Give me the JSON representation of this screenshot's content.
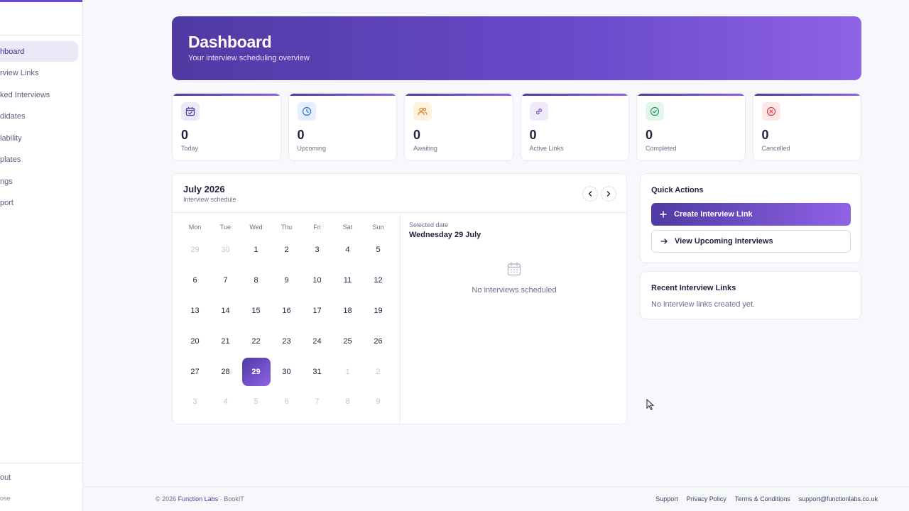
{
  "sidebar": {
    "items": [
      {
        "label": "Dashboard",
        "visible_text": "hboard",
        "active": true
      },
      {
        "label": "Interview Links",
        "visible_text": "rview Links"
      },
      {
        "label": "Booked Interviews",
        "visible_text": "ked Interviews"
      },
      {
        "label": "Candidates",
        "visible_text": "didates"
      },
      {
        "label": "Availability",
        "visible_text": "lability"
      },
      {
        "label": "Templates",
        "visible_text": "plates"
      },
      {
        "label": "Settings",
        "visible_text": "ngs"
      },
      {
        "label": "Support",
        "visible_text": "port"
      }
    ],
    "logout_text": "out",
    "collapse_text": "ose"
  },
  "hero": {
    "title": "Dashboard",
    "subtitle": "Your interview scheduling overview"
  },
  "stats": [
    {
      "value": "0",
      "label": "Today",
      "icon": "calendar-check-icon",
      "color": "#4f3aa3",
      "bg": "#ece8f8"
    },
    {
      "value": "0",
      "label": "Upcoming",
      "icon": "clock-icon",
      "color": "#2f6fe0",
      "bg": "#e6efff"
    },
    {
      "value": "0",
      "label": "Awaiting",
      "icon": "users-icon",
      "color": "#d98a1c",
      "bg": "#fff3e0"
    },
    {
      "value": "0",
      "label": "Active Links",
      "icon": "link-icon",
      "color": "#6a4bcc",
      "bg": "#f0ebfb"
    },
    {
      "value": "0",
      "label": "Completed",
      "icon": "check-circle-icon",
      "color": "#169a5a",
      "bg": "#e4f6ec"
    },
    {
      "value": "0",
      "label": "Cancelled",
      "icon": "x-circle-icon",
      "color": "#e0383e",
      "bg": "#fde8e8"
    }
  ],
  "calendar": {
    "month_title": "July 2026",
    "subtitle": "Interview schedule",
    "weekdays": [
      "Mon",
      "Tue",
      "Wed",
      "Thu",
      "Fri",
      "Sat",
      "Sun"
    ],
    "weeks": [
      [
        {
          "d": "29",
          "m": true
        },
        {
          "d": "30",
          "m": true
        },
        {
          "d": "1"
        },
        {
          "d": "2"
        },
        {
          "d": "3"
        },
        {
          "d": "4"
        },
        {
          "d": "5"
        }
      ],
      [
        {
          "d": "6"
        },
        {
          "d": "7"
        },
        {
          "d": "8"
        },
        {
          "d": "9"
        },
        {
          "d": "10"
        },
        {
          "d": "11"
        },
        {
          "d": "12"
        }
      ],
      [
        {
          "d": "13"
        },
        {
          "d": "14"
        },
        {
          "d": "15"
        },
        {
          "d": "16"
        },
        {
          "d": "17"
        },
        {
          "d": "18"
        },
        {
          "d": "19"
        }
      ],
      [
        {
          "d": "20"
        },
        {
          "d": "21"
        },
        {
          "d": "22"
        },
        {
          "d": "23"
        },
        {
          "d": "24"
        },
        {
          "d": "25"
        },
        {
          "d": "26"
        }
      ],
      [
        {
          "d": "27"
        },
        {
          "d": "28"
        },
        {
          "d": "29",
          "s": true
        },
        {
          "d": "30"
        },
        {
          "d": "31"
        },
        {
          "d": "1",
          "m": true
        },
        {
          "d": "2",
          "m": true
        }
      ],
      [
        {
          "d": "3",
          "m": true
        },
        {
          "d": "4",
          "m": true
        },
        {
          "d": "5",
          "m": true
        },
        {
          "d": "6",
          "m": true
        },
        {
          "d": "7",
          "m": true
        },
        {
          "d": "8",
          "m": true
        },
        {
          "d": "9",
          "m": true
        }
      ]
    ],
    "selected_label": "Selected date",
    "selected_date": "Wednesday 29 July",
    "empty_text": "No interviews scheduled"
  },
  "quick_actions": {
    "title": "Quick Actions",
    "create_label": "Create Interview Link",
    "view_label": "View Upcoming Interviews"
  },
  "recent_links": {
    "title": "Recent Interview Links",
    "empty_text": "No interview links created yet."
  },
  "footer": {
    "copyright": "© 2026 ",
    "brand": "Function Labs",
    "product": " · BookIT",
    "links": [
      "Support",
      "Privacy Policy",
      "Terms & Conditions",
      "support@functionlabs.co.uk"
    ]
  },
  "colors": {
    "accent": "#4f3aa3",
    "accent_light": "#8f62e6"
  }
}
